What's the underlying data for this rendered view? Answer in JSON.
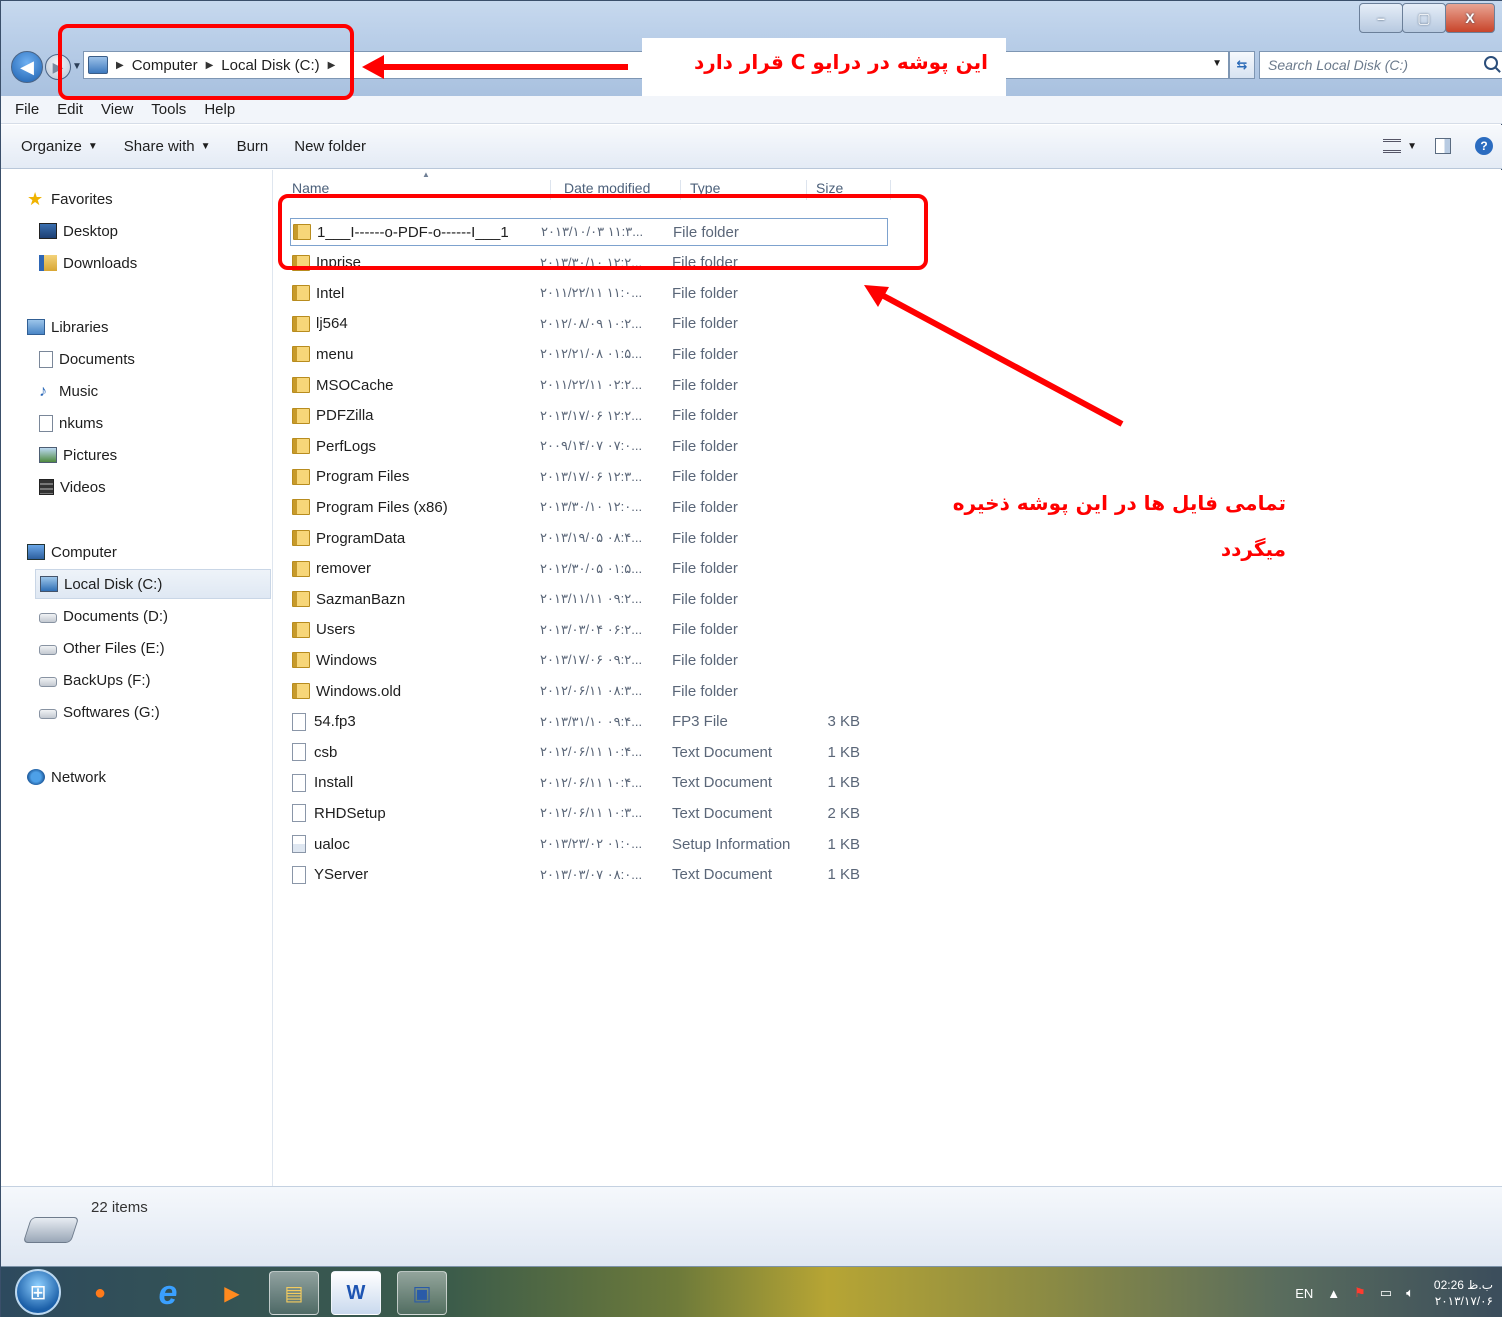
{
  "window": {
    "controls": {
      "minimize": "–",
      "maximize": "▢",
      "close": "X"
    }
  },
  "address": {
    "segments": [
      "Computer",
      "Local Disk (C:)"
    ],
    "search_placeholder": "Search Local Disk (C:)"
  },
  "menubar": {
    "items": [
      "File",
      "Edit",
      "View",
      "Tools",
      "Help"
    ]
  },
  "toolbar": {
    "organize": "Organize",
    "share_with": "Share with",
    "burn": "Burn",
    "new_folder": "New folder"
  },
  "navpane": {
    "favorites": {
      "label": "Favorites",
      "items": [
        "Desktop",
        "Downloads"
      ]
    },
    "libraries": {
      "label": "Libraries",
      "items": [
        "Documents",
        "Music",
        "nkums",
        "Pictures",
        "Videos"
      ]
    },
    "computer": {
      "label": "Computer",
      "items": [
        "Local Disk (C:)",
        "Documents (D:)",
        "Other Files (E:)",
        "BackUps (F:)",
        "Softwares (G:)"
      ],
      "selected": "Local Disk (C:)"
    },
    "network": {
      "label": "Network"
    }
  },
  "columns": {
    "name": "Name",
    "date": "Date modified",
    "type": "Type",
    "size": "Size"
  },
  "files": [
    {
      "name": "1___I------o-PDF-o------I___1",
      "date": "۲۰۱۳/۱۰/۰۳ ۱۱:۳...",
      "type": "File folder",
      "size": "",
      "kind": "folder",
      "selected": true
    },
    {
      "name": "Inprise",
      "date": "۲۰۱۳/۳۰/۱۰ ۱۲:۲...",
      "type": "File folder",
      "size": "",
      "kind": "folder"
    },
    {
      "name": "Intel",
      "date": "۲۰۱۱/۲۲/۱۱ ۱۱:۰...",
      "type": "File folder",
      "size": "",
      "kind": "folder"
    },
    {
      "name": "lj564",
      "date": "۲۰۱۲/۰۸/۰۹ ۱۰:۲...",
      "type": "File folder",
      "size": "",
      "kind": "folder"
    },
    {
      "name": "menu",
      "date": "۲۰۱۲/۲۱/۰۸ ۰۱:۵...",
      "type": "File folder",
      "size": "",
      "kind": "folder"
    },
    {
      "name": "MSOCache",
      "date": "۲۰۱۱/۲۲/۱۱ ۰۲:۲...",
      "type": "File folder",
      "size": "",
      "kind": "folder"
    },
    {
      "name": "PDFZilla",
      "date": "۲۰۱۳/۱۷/۰۶ ۱۲:۲...",
      "type": "File folder",
      "size": "",
      "kind": "folder"
    },
    {
      "name": "PerfLogs",
      "date": "۲۰۰۹/۱۴/۰۷ ۰۷:۰...",
      "type": "File folder",
      "size": "",
      "kind": "folder"
    },
    {
      "name": "Program Files",
      "date": "۲۰۱۳/۱۷/۰۶ ۱۲:۳...",
      "type": "File folder",
      "size": "",
      "kind": "folder"
    },
    {
      "name": "Program Files (x86)",
      "date": "۲۰۱۳/۳۰/۱۰ ۱۲:۰...",
      "type": "File folder",
      "size": "",
      "kind": "folder"
    },
    {
      "name": "ProgramData",
      "date": "۲۰۱۳/۱۹/۰۵ ۰۸:۴...",
      "type": "File folder",
      "size": "",
      "kind": "folder"
    },
    {
      "name": "remover",
      "date": "۲۰۱۲/۳۰/۰۵ ۰۱:۵...",
      "type": "File folder",
      "size": "",
      "kind": "folder"
    },
    {
      "name": "SazmanBazn",
      "date": "۲۰۱۳/۱۱/۱۱ ۰۹:۲...",
      "type": "File folder",
      "size": "",
      "kind": "folder"
    },
    {
      "name": "Users",
      "date": "۲۰۱۳/۰۳/۰۴ ۰۶:۲...",
      "type": "File folder",
      "size": "",
      "kind": "folder"
    },
    {
      "name": "Windows",
      "date": "۲۰۱۳/۱۷/۰۶ ۰۹:۲...",
      "type": "File folder",
      "size": "",
      "kind": "folder"
    },
    {
      "name": "Windows.old",
      "date": "۲۰۱۲/۰۶/۱۱ ۰۸:۳...",
      "type": "File folder",
      "size": "",
      "kind": "folder"
    },
    {
      "name": "54.fp3",
      "date": "۲۰۱۳/۳۱/۱۰ ۰۹:۴...",
      "type": "FP3 File",
      "size": "3 KB",
      "kind": "file"
    },
    {
      "name": "csb",
      "date": "۲۰۱۲/۰۶/۱۱ ۱۰:۴...",
      "type": "Text Document",
      "size": "1 KB",
      "kind": "file"
    },
    {
      "name": "Install",
      "date": "۲۰۱۲/۰۶/۱۱ ۱۰:۴...",
      "type": "Text Document",
      "size": "1 KB",
      "kind": "file"
    },
    {
      "name": "RHDSetup",
      "date": "۲۰۱۲/۰۶/۱۱ ۱۰:۳...",
      "type": "Text Document",
      "size": "2 KB",
      "kind": "file"
    },
    {
      "name": "ualoc",
      "date": "۲۰۱۳/۲۳/۰۲ ۰۱:۰...",
      "type": "Setup Information",
      "size": "1 KB",
      "kind": "setup"
    },
    {
      "name": "YServer",
      "date": "۲۰۱۳/۰۳/۰۷ ۰۸:۰...",
      "type": "Text Document",
      "size": "1 KB",
      "kind": "file"
    }
  ],
  "status": {
    "count": "22 items"
  },
  "taskbar": {
    "lang": "EN",
    "time": "02:26 ب.ظ",
    "date": "۲۰۱۳/۱۷/۰۶"
  },
  "annotations": {
    "drive_note": "این پوشه در درایو C قرار دارد",
    "folder_note_line1": "تمامی فایل ها در این پوشه ذخیره",
    "folder_note_line2": "میگردد",
    "color": "#ff0000"
  }
}
